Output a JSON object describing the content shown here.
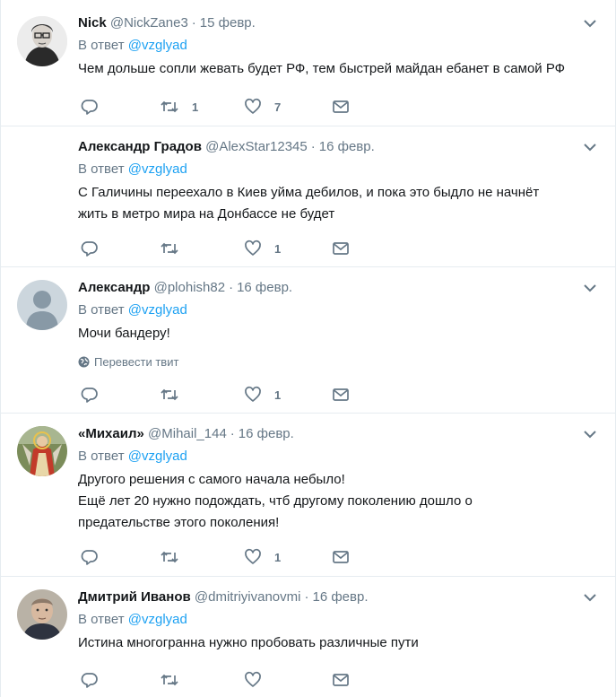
{
  "tweets": [
    {
      "name": "Nick",
      "handle": "@NickZane3",
      "time": "15 февр.",
      "reply_prefix": "В ответ",
      "reply_to": "@vzglyad",
      "lines": [
        "Чем дольше сопли жевать будет РФ, тем быстрей майдан ебанет в самой РФ"
      ],
      "retweets": "1",
      "likes": "7",
      "avatar_icon": "user-photo"
    },
    {
      "name": "Александр Градов",
      "handle": "@AlexStar12345",
      "time": "16 февр.",
      "reply_prefix": "В ответ",
      "reply_to": "@vzglyad",
      "lines": [
        "С Галичины переехало в Киев уйма дебилов, и пока это быдло не начнёт",
        "жить в метро мира на Донбассе не будет"
      ],
      "retweets": "",
      "likes": "1",
      "avatar_icon": "none"
    },
    {
      "name": "Александр",
      "handle": "@plohish82",
      "time": "16 февр.",
      "reply_prefix": "В ответ",
      "reply_to": "@vzglyad",
      "lines": [
        "Мочи бандеру!"
      ],
      "translate": "Перевести твит",
      "retweets": "",
      "likes": "1",
      "avatar_icon": "default-avatar"
    },
    {
      "name": "«Михаил»",
      "handle": "@Mihail_144",
      "time": "16 февр.",
      "reply_prefix": "В ответ",
      "reply_to": "@vzglyad",
      "lines": [
        "Другого решения с самого начала небыло!",
        "Ещё лет 20 нужно подождать, чтб другому поколению дошло о",
        "предательстве этого поколения!"
      ],
      "retweets": "",
      "likes": "1",
      "avatar_icon": "icon-image"
    },
    {
      "name": "Дмитрий Иванов",
      "handle": "@dmitriyivanovmi",
      "time": "16 февр.",
      "reply_prefix": "В ответ",
      "reply_to": "@vzglyad",
      "lines": [
        "Истина многогранна нужно пробовать различные пути"
      ],
      "retweets": "",
      "likes": "",
      "avatar_icon": "user-photo"
    }
  ],
  "colors": {
    "accent": "#1da1f2",
    "muted": "#657786",
    "text": "#14171a",
    "border": "#e6ecf0"
  }
}
